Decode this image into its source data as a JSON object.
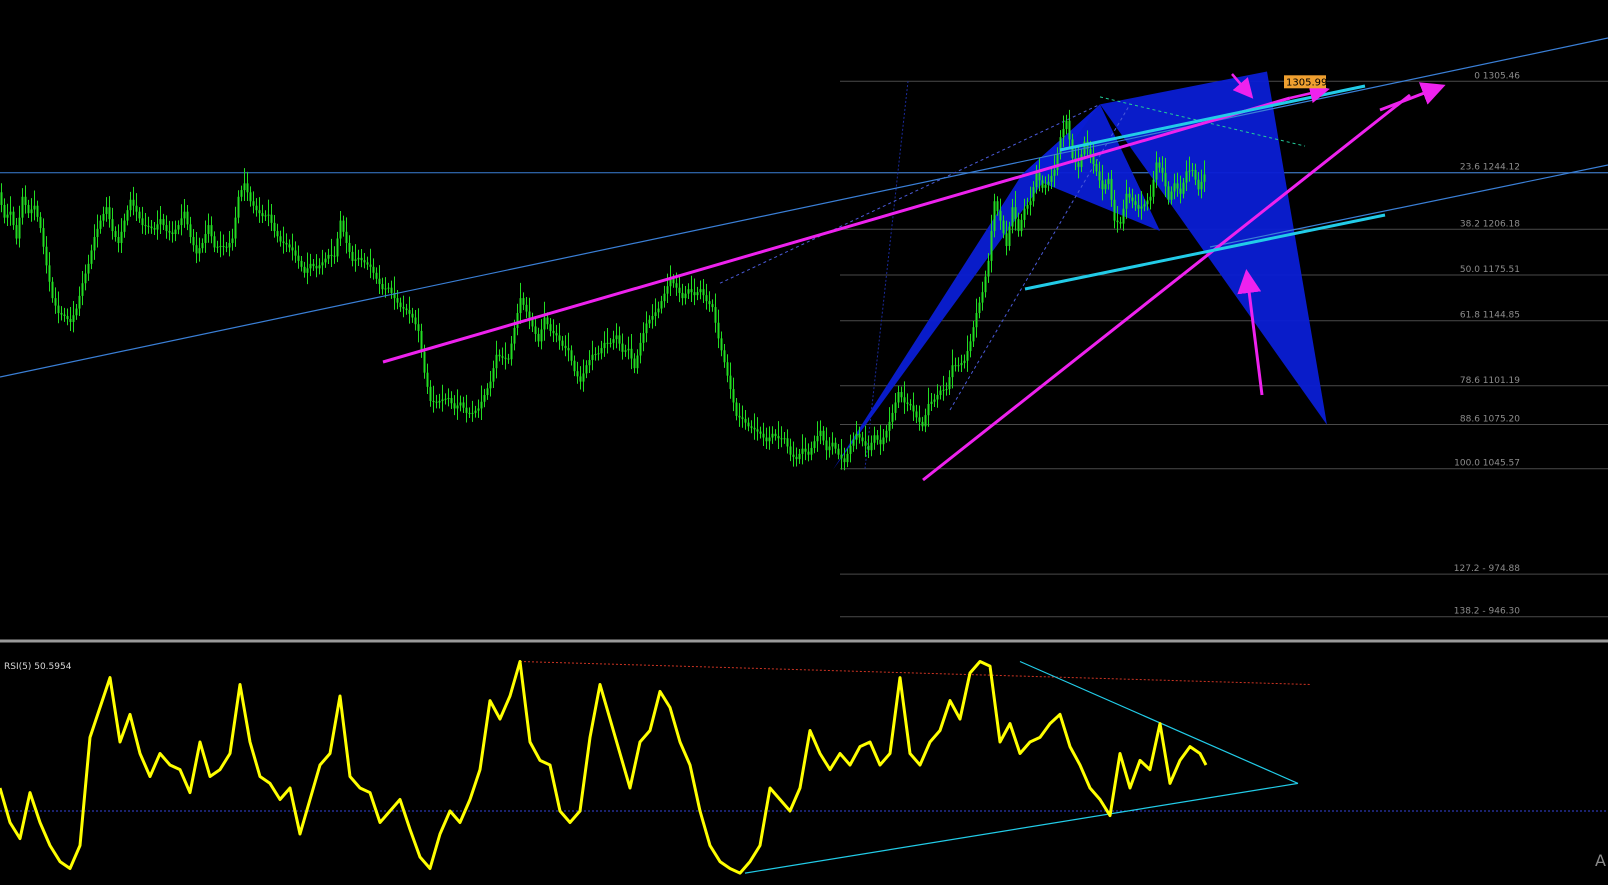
{
  "chart_data": {
    "type": "candlestick",
    "price_panel": {
      "ylim": [
        930,
        1360
      ],
      "candle_color": "#22dd22",
      "close_path": [
        [
          0,
          1231
        ],
        [
          6,
          1214
        ],
        [
          12,
          1218
        ],
        [
          18,
          1200
        ],
        [
          24,
          1228
        ],
        [
          30,
          1217
        ],
        [
          36,
          1222
        ],
        [
          42,
          1207
        ],
        [
          48,
          1182
        ],
        [
          54,
          1160
        ],
        [
          60,
          1150
        ],
        [
          66,
          1148
        ],
        [
          72,
          1144
        ],
        [
          78,
          1153
        ],
        [
          84,
          1170
        ],
        [
          90,
          1183
        ],
        [
          96,
          1201
        ],
        [
          102,
          1212
        ],
        [
          108,
          1221
        ],
        [
          114,
          1205
        ],
        [
          120,
          1197
        ],
        [
          126,
          1212
        ],
        [
          132,
          1226
        ],
        [
          138,
          1218
        ],
        [
          144,
          1209
        ],
        [
          150,
          1208
        ],
        [
          156,
          1206
        ],
        [
          162,
          1213
        ],
        [
          168,
          1205
        ],
        [
          174,
          1203
        ],
        [
          180,
          1209
        ],
        [
          186,
          1218
        ],
        [
          192,
          1201
        ],
        [
          198,
          1190
        ],
        [
          204,
          1197
        ],
        [
          210,
          1209
        ],
        [
          216,
          1194
        ],
        [
          222,
          1195
        ],
        [
          228,
          1194
        ],
        [
          234,
          1200
        ],
        [
          240,
          1228
        ],
        [
          246,
          1237
        ],
        [
          252,
          1225
        ],
        [
          258,
          1219
        ],
        [
          264,
          1215
        ],
        [
          270,
          1216
        ],
        [
          276,
          1205
        ],
        [
          282,
          1198
        ],
        [
          288,
          1196
        ],
        [
          294,
          1192
        ],
        [
          300,
          1185
        ],
        [
          306,
          1177
        ],
        [
          312,
          1183
        ],
        [
          318,
          1180
        ],
        [
          324,
          1184
        ],
        [
          330,
          1189
        ],
        [
          336,
          1188
        ],
        [
          342,
          1212
        ],
        [
          348,
          1197
        ],
        [
          354,
          1185
        ],
        [
          360,
          1187
        ],
        [
          366,
          1184
        ],
        [
          372,
          1181
        ],
        [
          378,
          1173
        ],
        [
          384,
          1166
        ],
        [
          390,
          1167
        ],
        [
          396,
          1160
        ],
        [
          402,
          1154
        ],
        [
          408,
          1152
        ],
        [
          414,
          1147
        ],
        [
          420,
          1138
        ],
        [
          426,
          1110
        ],
        [
          432,
          1091
        ],
        [
          438,
          1090
        ],
        [
          444,
          1092
        ],
        [
          450,
          1093
        ],
        [
          456,
          1086
        ],
        [
          462,
          1090
        ],
        [
          468,
          1083
        ],
        [
          474,
          1083
        ],
        [
          480,
          1086
        ],
        [
          486,
          1095
        ],
        [
          492,
          1104
        ],
        [
          498,
          1122
        ],
        [
          504,
          1120
        ],
        [
          510,
          1119
        ],
        [
          516,
          1140
        ],
        [
          522,
          1160
        ],
        [
          528,
          1151
        ],
        [
          534,
          1141
        ],
        [
          540,
          1131
        ],
        [
          546,
          1147
        ],
        [
          552,
          1138
        ],
        [
          558,
          1135
        ],
        [
          564,
          1128
        ],
        [
          570,
          1125
        ],
        [
          576,
          1111
        ],
        [
          582,
          1104
        ],
        [
          588,
          1115
        ],
        [
          594,
          1122
        ],
        [
          600,
          1123
        ],
        [
          606,
          1130
        ],
        [
          612,
          1130
        ],
        [
          618,
          1135
        ],
        [
          624,
          1124
        ],
        [
          630,
          1126
        ],
        [
          636,
          1113
        ],
        [
          642,
          1130
        ],
        [
          648,
          1143
        ],
        [
          654,
          1148
        ],
        [
          660,
          1153
        ],
        [
          666,
          1163
        ],
        [
          672,
          1173
        ],
        [
          678,
          1167
        ],
        [
          684,
          1160
        ],
        [
          690,
          1166
        ],
        [
          696,
          1162
        ],
        [
          702,
          1166
        ],
        [
          708,
          1158
        ],
        [
          714,
          1154
        ],
        [
          720,
          1133
        ],
        [
          726,
          1117
        ],
        [
          732,
          1099
        ],
        [
          738,
          1081
        ],
        [
          744,
          1079
        ],
        [
          750,
          1074
        ],
        [
          756,
          1072
        ],
        [
          762,
          1069
        ],
        [
          768,
          1064
        ],
        [
          774,
          1069
        ],
        [
          780,
          1066
        ],
        [
          786,
          1066
        ],
        [
          792,
          1055
        ],
        [
          798,
          1052
        ],
        [
          804,
          1059
        ],
        [
          810,
          1055
        ],
        [
          816,
          1064
        ],
        [
          822,
          1071
        ],
        [
          828,
          1058
        ],
        [
          834,
          1063
        ],
        [
          840,
          1055
        ],
        [
          846,
          1050
        ],
        [
          852,
          1061
        ],
        [
          858,
          1069
        ],
        [
          864,
          1064
        ],
        [
          870,
          1058
        ],
        [
          876,
          1068
        ],
        [
          882,
          1062
        ],
        [
          888,
          1071
        ],
        [
          894,
          1083
        ],
        [
          900,
          1097
        ],
        [
          906,
          1090
        ],
        [
          912,
          1088
        ],
        [
          918,
          1080
        ],
        [
          924,
          1074
        ],
        [
          930,
          1089
        ],
        [
          936,
          1092
        ],
        [
          942,
          1098
        ],
        [
          948,
          1099
        ],
        [
          954,
          1115
        ],
        [
          960,
          1115
        ],
        [
          966,
          1118
        ],
        [
          972,
          1131
        ],
        [
          978,
          1150
        ],
        [
          984,
          1164
        ],
        [
          990,
          1185
        ],
        [
          996,
          1225
        ],
        [
          1002,
          1212
        ],
        [
          1008,
          1195
        ],
        [
          1014,
          1221
        ],
        [
          1020,
          1205
        ],
        [
          1026,
          1220
        ],
        [
          1032,
          1225
        ],
        [
          1038,
          1244
        ],
        [
          1044,
          1234
        ],
        [
          1050,
          1238
        ],
        [
          1056,
          1246
        ],
        [
          1062,
          1268
        ],
        [
          1068,
          1279
        ],
        [
          1074,
          1254
        ],
        [
          1080,
          1248
        ],
        [
          1086,
          1265
        ],
        [
          1092,
          1255
        ],
        [
          1098,
          1245
        ],
        [
          1104,
          1233
        ],
        [
          1110,
          1240
        ],
        [
          1116,
          1212
        ],
        [
          1122,
          1210
        ],
        [
          1128,
          1230
        ],
        [
          1134,
          1225
        ],
        [
          1140,
          1220
        ],
        [
          1146,
          1223
        ],
        [
          1152,
          1228
        ],
        [
          1158,
          1251
        ],
        [
          1164,
          1244
        ],
        [
          1170,
          1226
        ],
        [
          1176,
          1237
        ],
        [
          1182,
          1230
        ],
        [
          1188,
          1245
        ],
        [
          1194,
          1246
        ],
        [
          1200,
          1233
        ],
        [
          1206,
          1243
        ]
      ]
    },
    "fibonacci": {
      "levels": [
        {
          "label": "0 1305.46",
          "value": 1305.46
        },
        {
          "label": "23.6 1244.12",
          "value": 1244.12
        },
        {
          "label": "38.2 1206.18",
          "value": 1206.18
        },
        {
          "label": "50.0 1175.51",
          "value": 1175.51
        },
        {
          "label": "61.8 1144.85",
          "value": 1144.85
        },
        {
          "label": "78.6 1101.19",
          "value": 1101.19
        },
        {
          "label": "88.6 1075.20",
          "value": 1075.2
        },
        {
          "label": "100.0 1045.57",
          "value": 1045.57
        },
        {
          "label": "127.2 - 974.88",
          "value": 974.88
        },
        {
          "label": "138.2 - 946.30",
          "value": 946.3
        }
      ],
      "line_color": "#4a4a4a"
    },
    "current_price_tag": "1305.99",
    "rsi": {
      "title": "RSI(5) 50.5954",
      "ylim": [
        0,
        100
      ],
      "line_color": "#ffff00",
      "values": [
        [
          0,
          40
        ],
        [
          10,
          25
        ],
        [
          20,
          18
        ],
        [
          30,
          38
        ],
        [
          40,
          25
        ],
        [
          50,
          15
        ],
        [
          60,
          8
        ],
        [
          70,
          5
        ],
        [
          80,
          15
        ],
        [
          90,
          62
        ],
        [
          100,
          75
        ],
        [
          110,
          88
        ],
        [
          120,
          60
        ],
        [
          130,
          72
        ],
        [
          140,
          55
        ],
        [
          150,
          45
        ],
        [
          160,
          55
        ],
        [
          170,
          50
        ],
        [
          180,
          48
        ],
        [
          190,
          38
        ],
        [
          200,
          60
        ],
        [
          210,
          45
        ],
        [
          220,
          48
        ],
        [
          230,
          55
        ],
        [
          240,
          85
        ],
        [
          250,
          60
        ],
        [
          260,
          45
        ],
        [
          270,
          42
        ],
        [
          280,
          35
        ],
        [
          290,
          40
        ],
        [
          300,
          20
        ],
        [
          310,
          35
        ],
        [
          320,
          50
        ],
        [
          330,
          55
        ],
        [
          340,
          80
        ],
        [
          350,
          45
        ],
        [
          360,
          40
        ],
        [
          370,
          38
        ],
        [
          380,
          25
        ],
        [
          390,
          30
        ],
        [
          400,
          35
        ],
        [
          410,
          22
        ],
        [
          420,
          10
        ],
        [
          430,
          5
        ],
        [
          440,
          20
        ],
        [
          450,
          30
        ],
        [
          460,
          25
        ],
        [
          470,
          35
        ],
        [
          480,
          48
        ],
        [
          490,
          78
        ],
        [
          500,
          70
        ],
        [
          510,
          80
        ],
        [
          520,
          95
        ],
        [
          530,
          60
        ],
        [
          540,
          52
        ],
        [
          550,
          50
        ],
        [
          560,
          30
        ],
        [
          570,
          25
        ],
        [
          580,
          30
        ],
        [
          590,
          62
        ],
        [
          600,
          85
        ],
        [
          610,
          70
        ],
        [
          620,
          55
        ],
        [
          630,
          40
        ],
        [
          640,
          60
        ],
        [
          650,
          65
        ],
        [
          660,
          82
        ],
        [
          670,
          75
        ],
        [
          680,
          60
        ],
        [
          690,
          50
        ],
        [
          700,
          30
        ],
        [
          710,
          15
        ],
        [
          720,
          8
        ],
        [
          730,
          5
        ],
        [
          740,
          3
        ],
        [
          750,
          8
        ],
        [
          760,
          15
        ],
        [
          770,
          40
        ],
        [
          780,
          35
        ],
        [
          790,
          30
        ],
        [
          800,
          40
        ],
        [
          810,
          65
        ],
        [
          820,
          55
        ],
        [
          830,
          48
        ],
        [
          840,
          55
        ],
        [
          850,
          50
        ],
        [
          860,
          58
        ],
        [
          870,
          60
        ],
        [
          880,
          50
        ],
        [
          890,
          55
        ],
        [
          900,
          88
        ],
        [
          910,
          55
        ],
        [
          920,
          50
        ],
        [
          930,
          60
        ],
        [
          940,
          65
        ],
        [
          950,
          78
        ],
        [
          960,
          70
        ],
        [
          970,
          90
        ],
        [
          980,
          95
        ],
        [
          990,
          93
        ],
        [
          1000,
          60
        ],
        [
          1010,
          68
        ],
        [
          1020,
          55
        ],
        [
          1030,
          60
        ],
        [
          1040,
          62
        ],
        [
          1050,
          68
        ],
        [
          1060,
          72
        ],
        [
          1070,
          58
        ],
        [
          1080,
          50
        ],
        [
          1090,
          40
        ],
        [
          1100,
          35
        ],
        [
          1110,
          28
        ],
        [
          1120,
          55
        ],
        [
          1130,
          40
        ],
        [
          1140,
          52
        ],
        [
          1150,
          48
        ],
        [
          1160,
          68
        ],
        [
          1170,
          42
        ],
        [
          1180,
          52
        ],
        [
          1190,
          58
        ],
        [
          1200,
          55
        ],
        [
          1206,
          50
        ]
      ],
      "reference_line": 30,
      "reference_color": "#3344dd"
    },
    "colors": {
      "background": "#000000",
      "pattern_fill": "#0a1ed4",
      "trend_magenta": "#ee22ee",
      "trend_cyan": "#22cce8",
      "channel_blue": "#3a7fd6"
    },
    "corner_glyph": "A"
  }
}
